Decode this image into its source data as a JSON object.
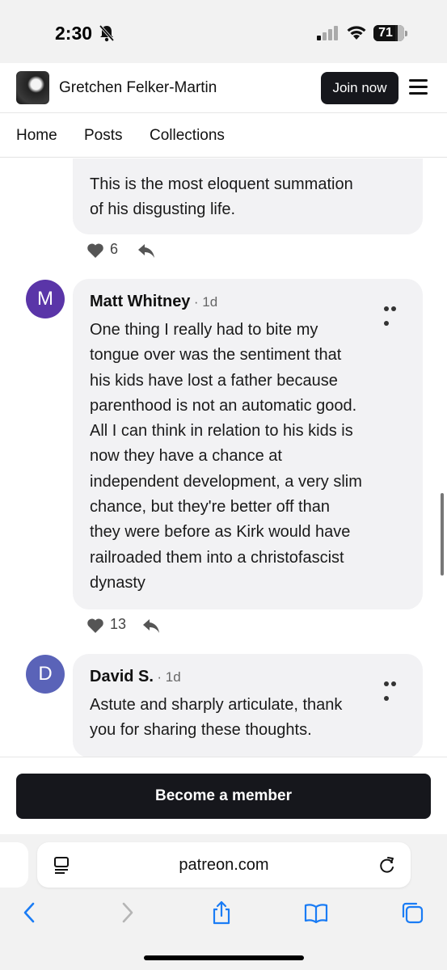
{
  "status_bar": {
    "time": "2:30",
    "battery": "71",
    "battery_level": 0.71
  },
  "creator": {
    "name": "Gretchen Felker-Martin",
    "join_label": "Join now"
  },
  "nav": {
    "tabs": [
      "Home",
      "Posts",
      "Collections"
    ]
  },
  "comments": [
    {
      "text_lines": [
        "This is the most eloquent summation",
        "of his disgusting life."
      ],
      "likes": "6"
    },
    {
      "avatar_letter": "M",
      "avatar_color": "#5a35a8",
      "author": "Matt Whitney",
      "time": "· 1d",
      "text_lines": [
        "One thing I really had to bite my",
        "tongue over was the sentiment that",
        "his kids have lost a father because",
        "parenthood is not an automatic good.",
        "All I can think in relation to his kids is",
        "now they have a chance at",
        "independent development, a very slim",
        "chance, but they're better off than",
        "they were before as Kirk would have",
        "railroaded them into a christofascist",
        "dynasty"
      ],
      "likes": "13"
    },
    {
      "avatar_letter": "D",
      "avatar_color": "#5a63b8",
      "author": "David S.",
      "time": "· 1d",
      "text_lines": [
        "Astute and sharply articulate, thank",
        "you for sharing these thoughts."
      ]
    }
  ],
  "member": {
    "button_label": "Become a member"
  },
  "browser": {
    "url": "patreon.com"
  },
  "icons": {
    "bell": "bell-slash-icon",
    "signal": "signal-icon",
    "wifi": "wifi-icon",
    "menu": "hamburger-menu-icon",
    "more": "more-icon",
    "heart": "heart-icon",
    "reply": "reply-icon",
    "reader": "reader-mode-icon",
    "reload": "reload-icon",
    "back": "back-icon",
    "forward": "forward-icon",
    "share": "share-icon",
    "bookmarks": "bookmarks-icon",
    "tabs": "tabs-icon"
  },
  "colors": {
    "button_dark": "#16171c",
    "bubble": "#f2f2f4",
    "safari_blue": "#1a7cf5"
  }
}
